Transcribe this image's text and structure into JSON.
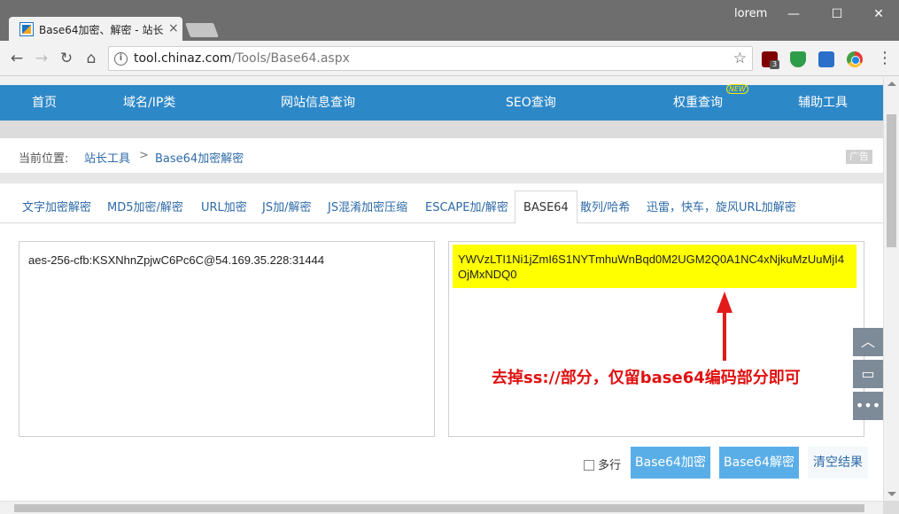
{
  "browser": {
    "tab_title": "Base64加密、解密 - 站长",
    "tab_close": "×",
    "profile_name": "lorem",
    "window_controls": {
      "minimize": "—",
      "maximize": "☐",
      "close": "✕"
    },
    "url_host": "tool.chinaz.com",
    "url_path": "/Tools/Base64.aspx",
    "ublock_count": "3",
    "icons": [
      "back-icon",
      "forward-icon",
      "reload-icon",
      "home-icon",
      "info-icon",
      "bookmark-star-icon",
      "ublock-icon",
      "shield-icon",
      "save-icon",
      "chrome-icon",
      "menu-icon"
    ]
  },
  "nav": {
    "items": [
      "首页",
      "域名/IP类",
      "网站信息查询",
      "SEO查询",
      "权重查询",
      "辅助工具"
    ],
    "new_badge": "NEW"
  },
  "breadcrumb": {
    "label": "当前位置:",
    "items": [
      "站长工具",
      "Base64加密解密"
    ],
    "separator": ">",
    "ad": "广告"
  },
  "tool_tabs": {
    "items": [
      "文字加密解密",
      "MD5加密/解密",
      "URL加密",
      "JS加/解密",
      "JS混淆加密压缩",
      "ESCAPE加/解密",
      "BASE64",
      "散列/哈希",
      "迅雷，快车，旋风URL加解密"
    ],
    "active": "BASE64"
  },
  "input": {
    "value": "aes-256-cfb:KSXNhnZpjwC6Pc6C@54.169.35.228:31444"
  },
  "output": {
    "value": "YWVzLTI1Ni1jZmI6S1NYTmhuWnBqd0M2UGM2Q0A1NC4xNjkuMzUuMjI4OjMxNDQ0"
  },
  "annotation": {
    "text": "去掉ss://部分，仅留base64编码部分即可",
    "color": "#e01010"
  },
  "actions": {
    "multiline_label": "多行",
    "encode_label": "Base64加密",
    "decode_label": "Base64解密",
    "clear_label": "清空结果"
  },
  "side_buttons": [
    "back-to-top-icon",
    "feedback-icon",
    "more-icon"
  ],
  "colors": {
    "nav_bg": "#2d88c8",
    "button_bg": "#5aaee8",
    "highlight": "#ffff00",
    "annotation": "#e01010"
  }
}
